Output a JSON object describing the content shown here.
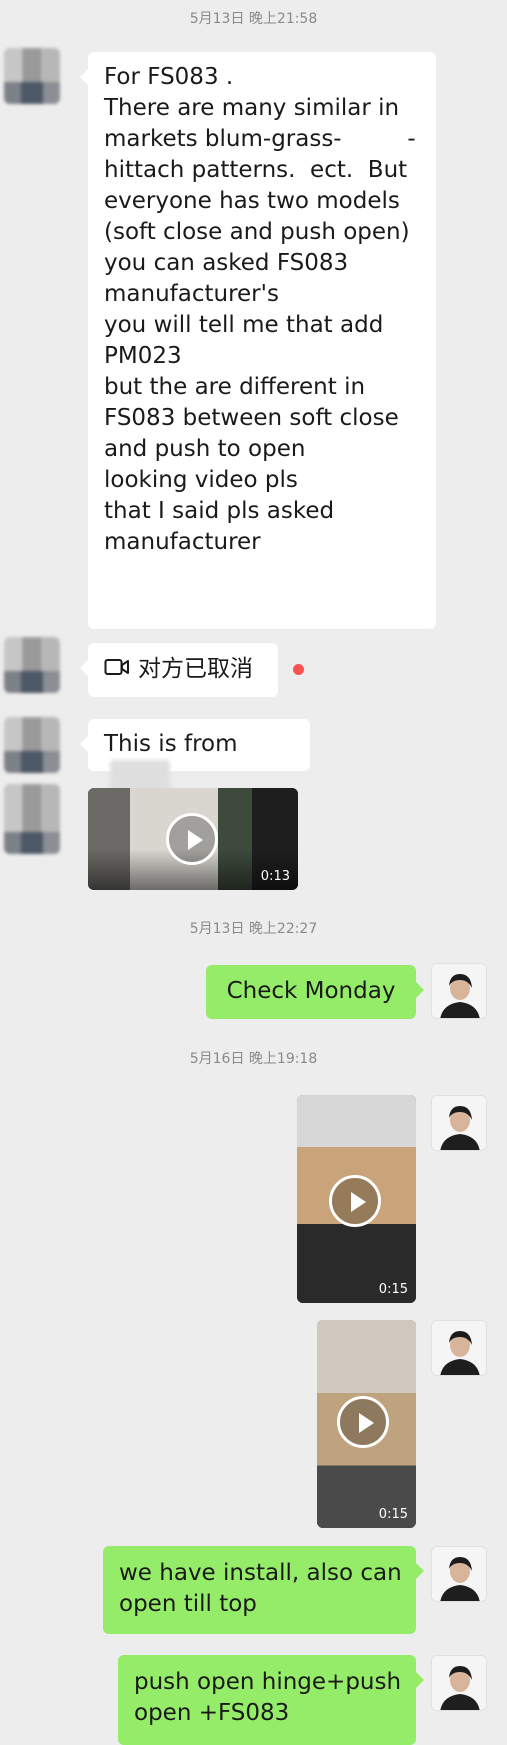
{
  "timestamps": [
    "5月13日 晚上21:58",
    "5月13日 晚上22:27",
    "5月16日 晚上19:18"
  ],
  "messages": {
    "fs083_note": [
      "For FS083 .",
      "There are many similar in",
      "markets blum-grass-         -",
      "hittach patterns.  ect.  But",
      "everyone has two models",
      "(soft close and push open)",
      "you can asked FS083",
      "manufacturer's",
      "you will tell me that add",
      "PM023",
      "but the are different in",
      "FS083 between soft close",
      "and push to open",
      "looking video pls",
      "that I said pls asked",
      "manufacturer"
    ],
    "call_cancelled": "对方已取消",
    "this_is_from": "This is from",
    "video_1_duration": "0:13",
    "check_monday": "Check Monday",
    "video_2_duration": "0:15",
    "video_3_duration": "0:15",
    "install_note": [
      "we have install, also can",
      "open till top"
    ],
    "push_open_note": [
      "push open hinge+push",
      "open +FS083"
    ]
  },
  "icons": {
    "video_call": "video-camera-icon",
    "unread_dot": "red-dot",
    "play": "play-icon"
  },
  "colors": {
    "background": "#ededed",
    "incoming_bubble": "#ffffff",
    "outgoing_bubble": "#95ec69",
    "timestamp": "#8a8a8a",
    "unread_dot": "#fa5151"
  }
}
